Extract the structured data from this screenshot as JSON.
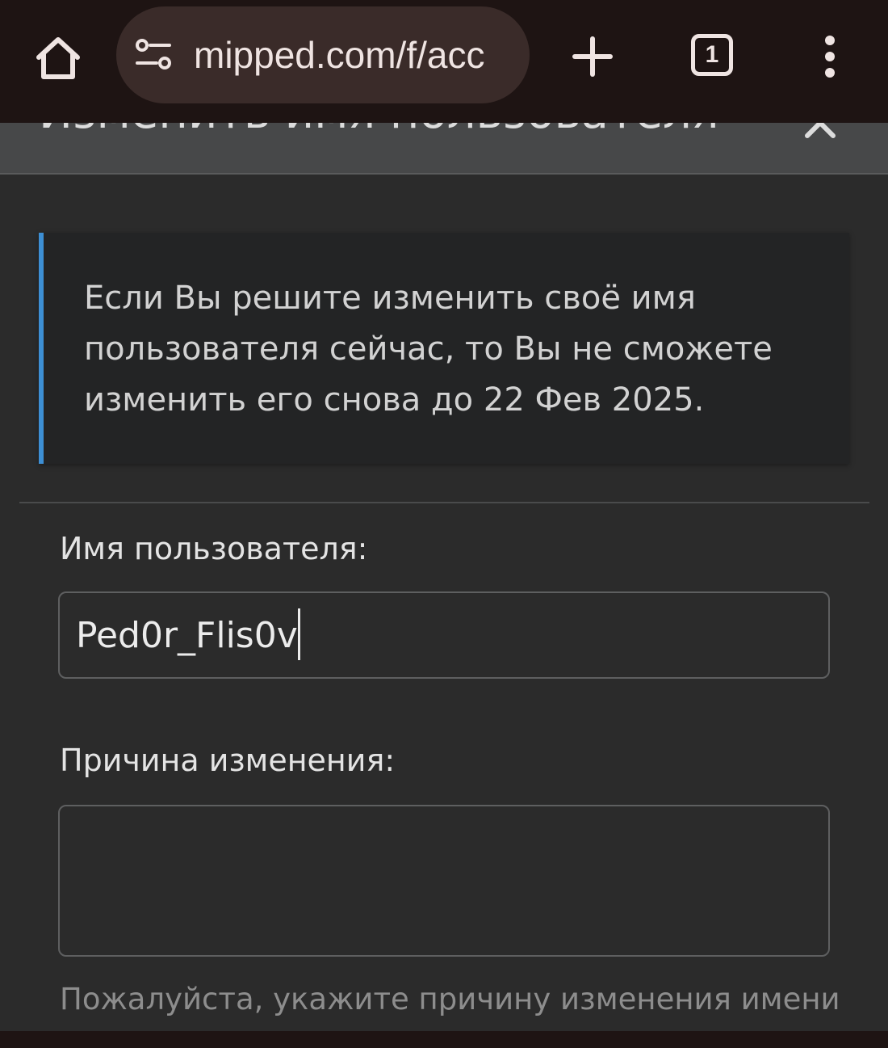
{
  "browser": {
    "url": "mipped.com/f/acc",
    "tab_count": "1",
    "icons": {
      "home": "home-icon",
      "site_settings": "site-settings-icon",
      "new_tab": "plus-icon",
      "menu": "more-vertical-icon"
    }
  },
  "dialog": {
    "title": "Изменить имя пользователя",
    "close_icon": "close-icon",
    "notice": "Если Вы решите изменить своё имя пользователя сейчас, то Вы не сможете изменить его снова до 22 Фев 2025.",
    "username_label": "Имя пользователя:",
    "username_value": "Ped0r_Flis0v",
    "reason_label": "Причина изменения:",
    "reason_value": "",
    "reason_hint": "Пожалуйста, укажите причину изменения имени"
  },
  "colors": {
    "browser_bar": "#1e1413",
    "omnibox": "#3a2b29",
    "page_background": "#2b2b2b",
    "header_background": "#474849",
    "notice_background": "#232425",
    "notice_accent": "#3d8fd4"
  }
}
